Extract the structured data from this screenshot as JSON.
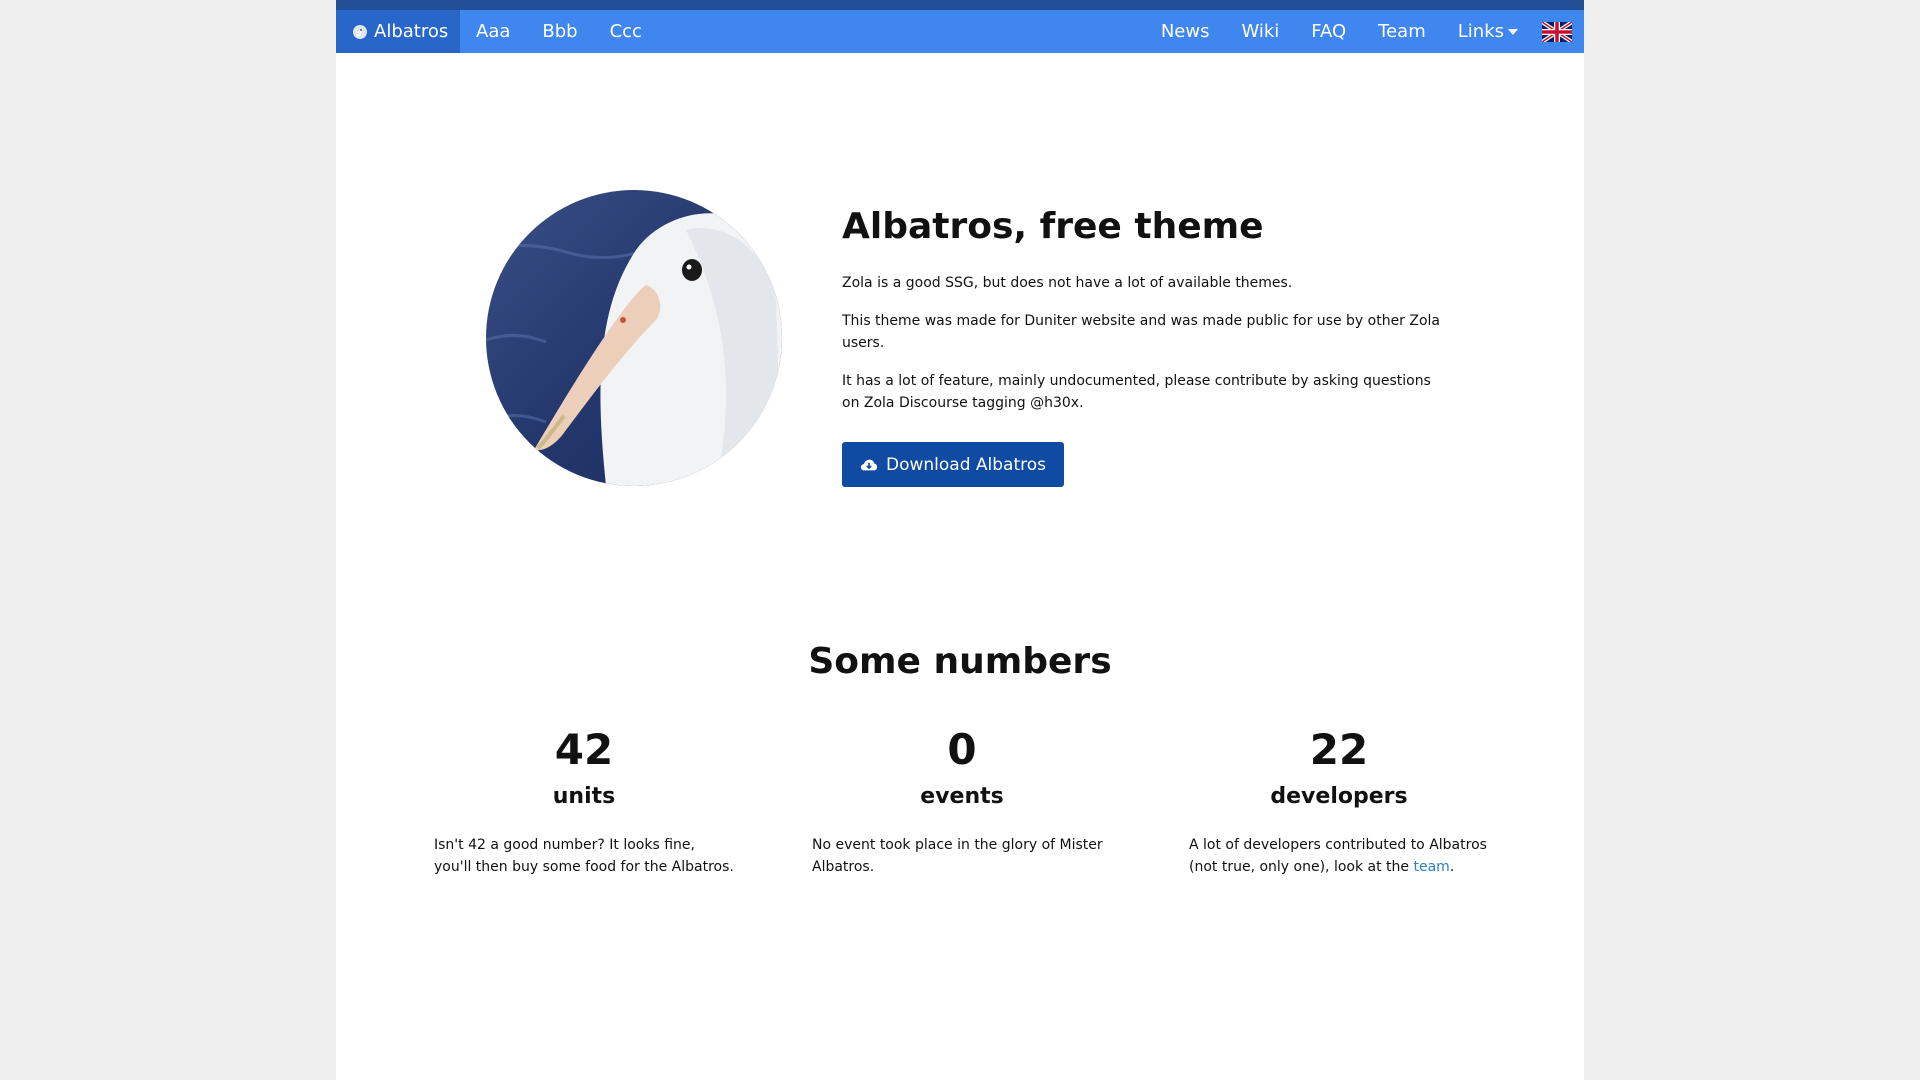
{
  "navbar": {
    "brand_label": "Albatros",
    "left_items": [
      "Aaa",
      "Bbb",
      "Ccc"
    ],
    "right_items": [
      "News",
      "Wiki",
      "FAQ",
      "Team"
    ],
    "links_label": "Links",
    "colors": {
      "bar": "#3f86ee",
      "brand_bg": "#2966c9",
      "top_strip": "#234f96"
    }
  },
  "hero": {
    "title": "Albatros, free theme",
    "paragraphs": [
      "Zola is a good SSG, but does not have a lot of available themes.",
      "This theme was made for Duniter website and was made public for use by other Zola users.",
      "It has a lot of feature, mainly undocumented, please contribute by asking questions on Zola Discourse tagging @h30x."
    ],
    "button_label": "Download Albatros",
    "button_icon": "cloud-download-icon",
    "button_color": "#0f4aa3"
  },
  "numbers": {
    "title": "Some numbers",
    "stats": [
      {
        "value": "42",
        "unit": "units",
        "description": "Isn't 42 a good number? It looks fine, you'll then buy some food for the Albatros."
      },
      {
        "value": "0",
        "unit": "events",
        "description": "No event took place in the glory of Mister Albatros."
      },
      {
        "value": "22",
        "unit": "developers",
        "description_before": "A lot of developers contributed to Albatros (not true, only one), look at the ",
        "link_text": "team",
        "description_after": "."
      }
    ]
  }
}
